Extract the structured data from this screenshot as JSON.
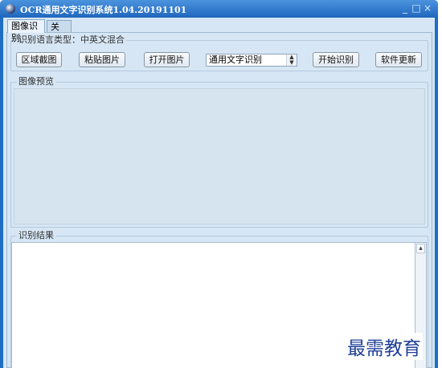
{
  "window": {
    "title": "OCR通用文字识别系统1.04.20191101",
    "controls": {
      "minimize": "_",
      "maximize": "□",
      "close": "×"
    },
    "icon": "app-orb-icon"
  },
  "tabs": [
    {
      "label": "图像识别",
      "active": true
    },
    {
      "label": "关于",
      "active": false
    }
  ],
  "language_group": {
    "legend": "识别语言类型：中英文混合",
    "buttons": {
      "region": "区域截图",
      "paste": "粘贴图片",
      "open": "打开图片",
      "start": "开始识别",
      "update": "软件更新"
    },
    "mode_select": {
      "value": "通用文字识别"
    }
  },
  "preview_group": {
    "legend": "图像预览"
  },
  "result_group": {
    "legend": "识别结果",
    "text": ""
  },
  "watermark": "最需教育",
  "colors": {
    "titlebar": "#1f67be",
    "client": "#d6e6f4",
    "frame": "#1e6ec4"
  }
}
